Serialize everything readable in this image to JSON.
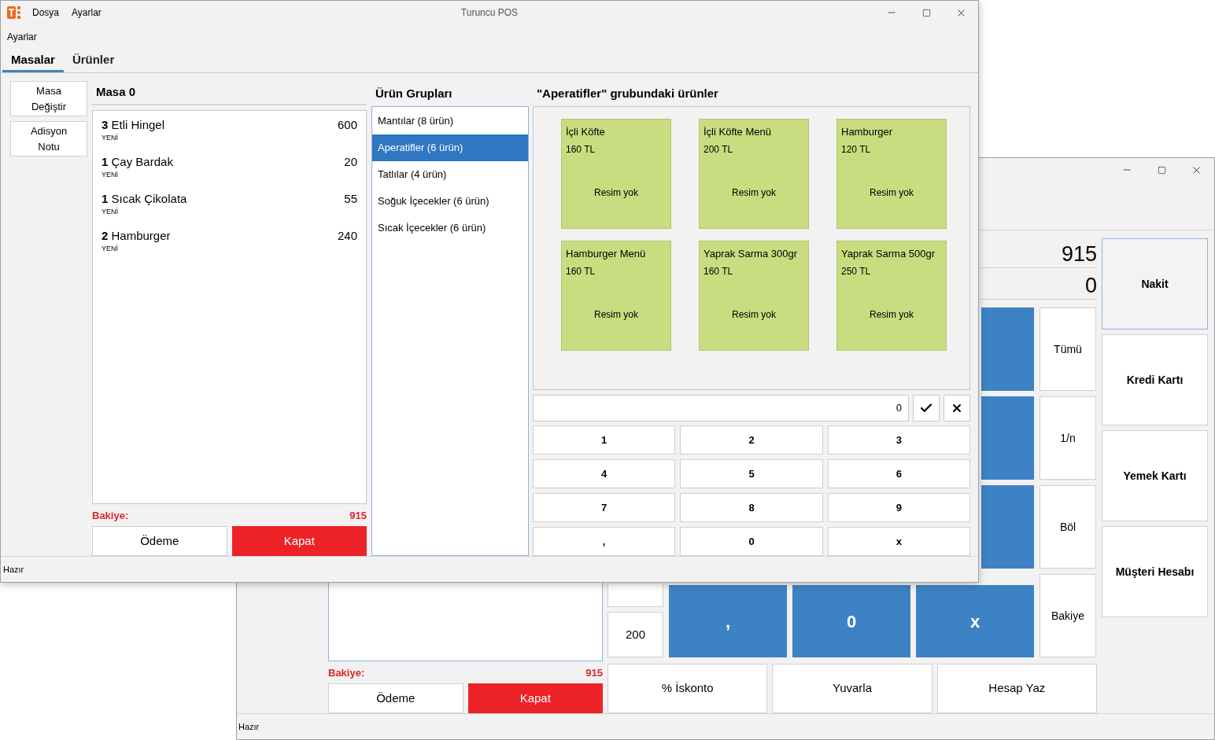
{
  "back_window": {
    "displays": [
      {
        "kind": "total",
        "value": "915"
      },
      {
        "kind": "entered",
        "value": "0"
      }
    ],
    "quick_amounts": [
      {
        "kind": "cut"
      },
      {
        "label": "200",
        "kind": "full"
      }
    ],
    "keypad_last_row": [
      ",",
      "0",
      "x"
    ],
    "split_buttons": [
      "Tümü",
      "1/n",
      "Böl",
      "Bakiye"
    ],
    "actions": [
      "% İskonto",
      "Yuvarla",
      "Hesap Yaz"
    ],
    "payment_methods": [
      {
        "label": "Nakit",
        "selected": true
      },
      {
        "label": "Kredi Kartı",
        "selected": false
      },
      {
        "label": "Yemek Kartı",
        "selected": false
      },
      {
        "label": "Müşteri Hesabı",
        "selected": false
      }
    ],
    "balance": {
      "label": "Bakiye:",
      "value": "915"
    },
    "buttons": [
      {
        "label": "Ödeme",
        "kind": "normal"
      },
      {
        "label": "Kapat",
        "kind": "danger"
      }
    ],
    "status_bar": "Hazır"
  },
  "front_window": {
    "menu": [
      "Dosya",
      "Ayarlar"
    ],
    "title": "Turuncu POS",
    "toolbar_label": "Ayarlar",
    "tabs": [
      {
        "label": "Masalar",
        "selected": true
      },
      {
        "label": "Ürünler",
        "selected": false
      }
    ],
    "side_buttons": [
      [
        "Masa",
        "Değiştir"
      ],
      [
        "Adisyon",
        "Notu"
      ]
    ],
    "table_title": "Masa 0",
    "order_items": [
      {
        "qty": "3",
        "name": "Etli Hingel",
        "price": "600",
        "status": "YENİ"
      },
      {
        "qty": "1",
        "name": "Çay Bardak",
        "price": "20",
        "status": "YENİ"
      },
      {
        "qty": "1",
        "name": "Sıcak Çikolata",
        "price": "55",
        "status": "YENİ"
      },
      {
        "qty": "2",
        "name": "Hamburger",
        "price": "240",
        "status": "YENİ"
      }
    ],
    "balance": {
      "label": "Bakiye:",
      "value": "915"
    },
    "buttons": [
      {
        "label": "Ödeme",
        "kind": "normal"
      },
      {
        "label": "Kapat",
        "kind": "danger"
      }
    ],
    "groups_title": "Ürün Grupları",
    "groups": [
      {
        "label": "Mantılar (8 ürün)",
        "selected": false
      },
      {
        "label": "Aperatifler (6 ürün)",
        "selected": true
      },
      {
        "label": "Tatlılar (4 ürün)",
        "selected": false
      },
      {
        "label": "Soğuk İçecekler (6 ürün)",
        "selected": false
      },
      {
        "label": "Sıcak İçecekler (6 ürün)",
        "selected": false
      }
    ],
    "products_title": "\"Aperatifler\" grubundaki ürünler",
    "products": [
      {
        "name": "İçli Köfte",
        "price": "160 TL",
        "image": "Resim yok"
      },
      {
        "name": "İçli Köfte Menü",
        "price": "200 TL",
        "image": "Resim yok"
      },
      {
        "name": "Hamburger",
        "price": "120 TL",
        "image": "Resim yok"
      },
      {
        "name": "Hamburger Menü",
        "price": "160 TL",
        "image": "Resim yok"
      },
      {
        "name": "Yaprak Sarma 300gr",
        "price": "160 TL",
        "image": "Resim yok"
      },
      {
        "name": "Yaprak Sarma 500gr",
        "price": "250 TL",
        "image": "Resim yok"
      }
    ],
    "quantity_value": "0",
    "keypad": [
      "1",
      "2",
      "3",
      "4",
      "5",
      "6",
      "7",
      "8",
      "9",
      ",",
      "0",
      "x"
    ],
    "status_bar": "Hazır"
  }
}
